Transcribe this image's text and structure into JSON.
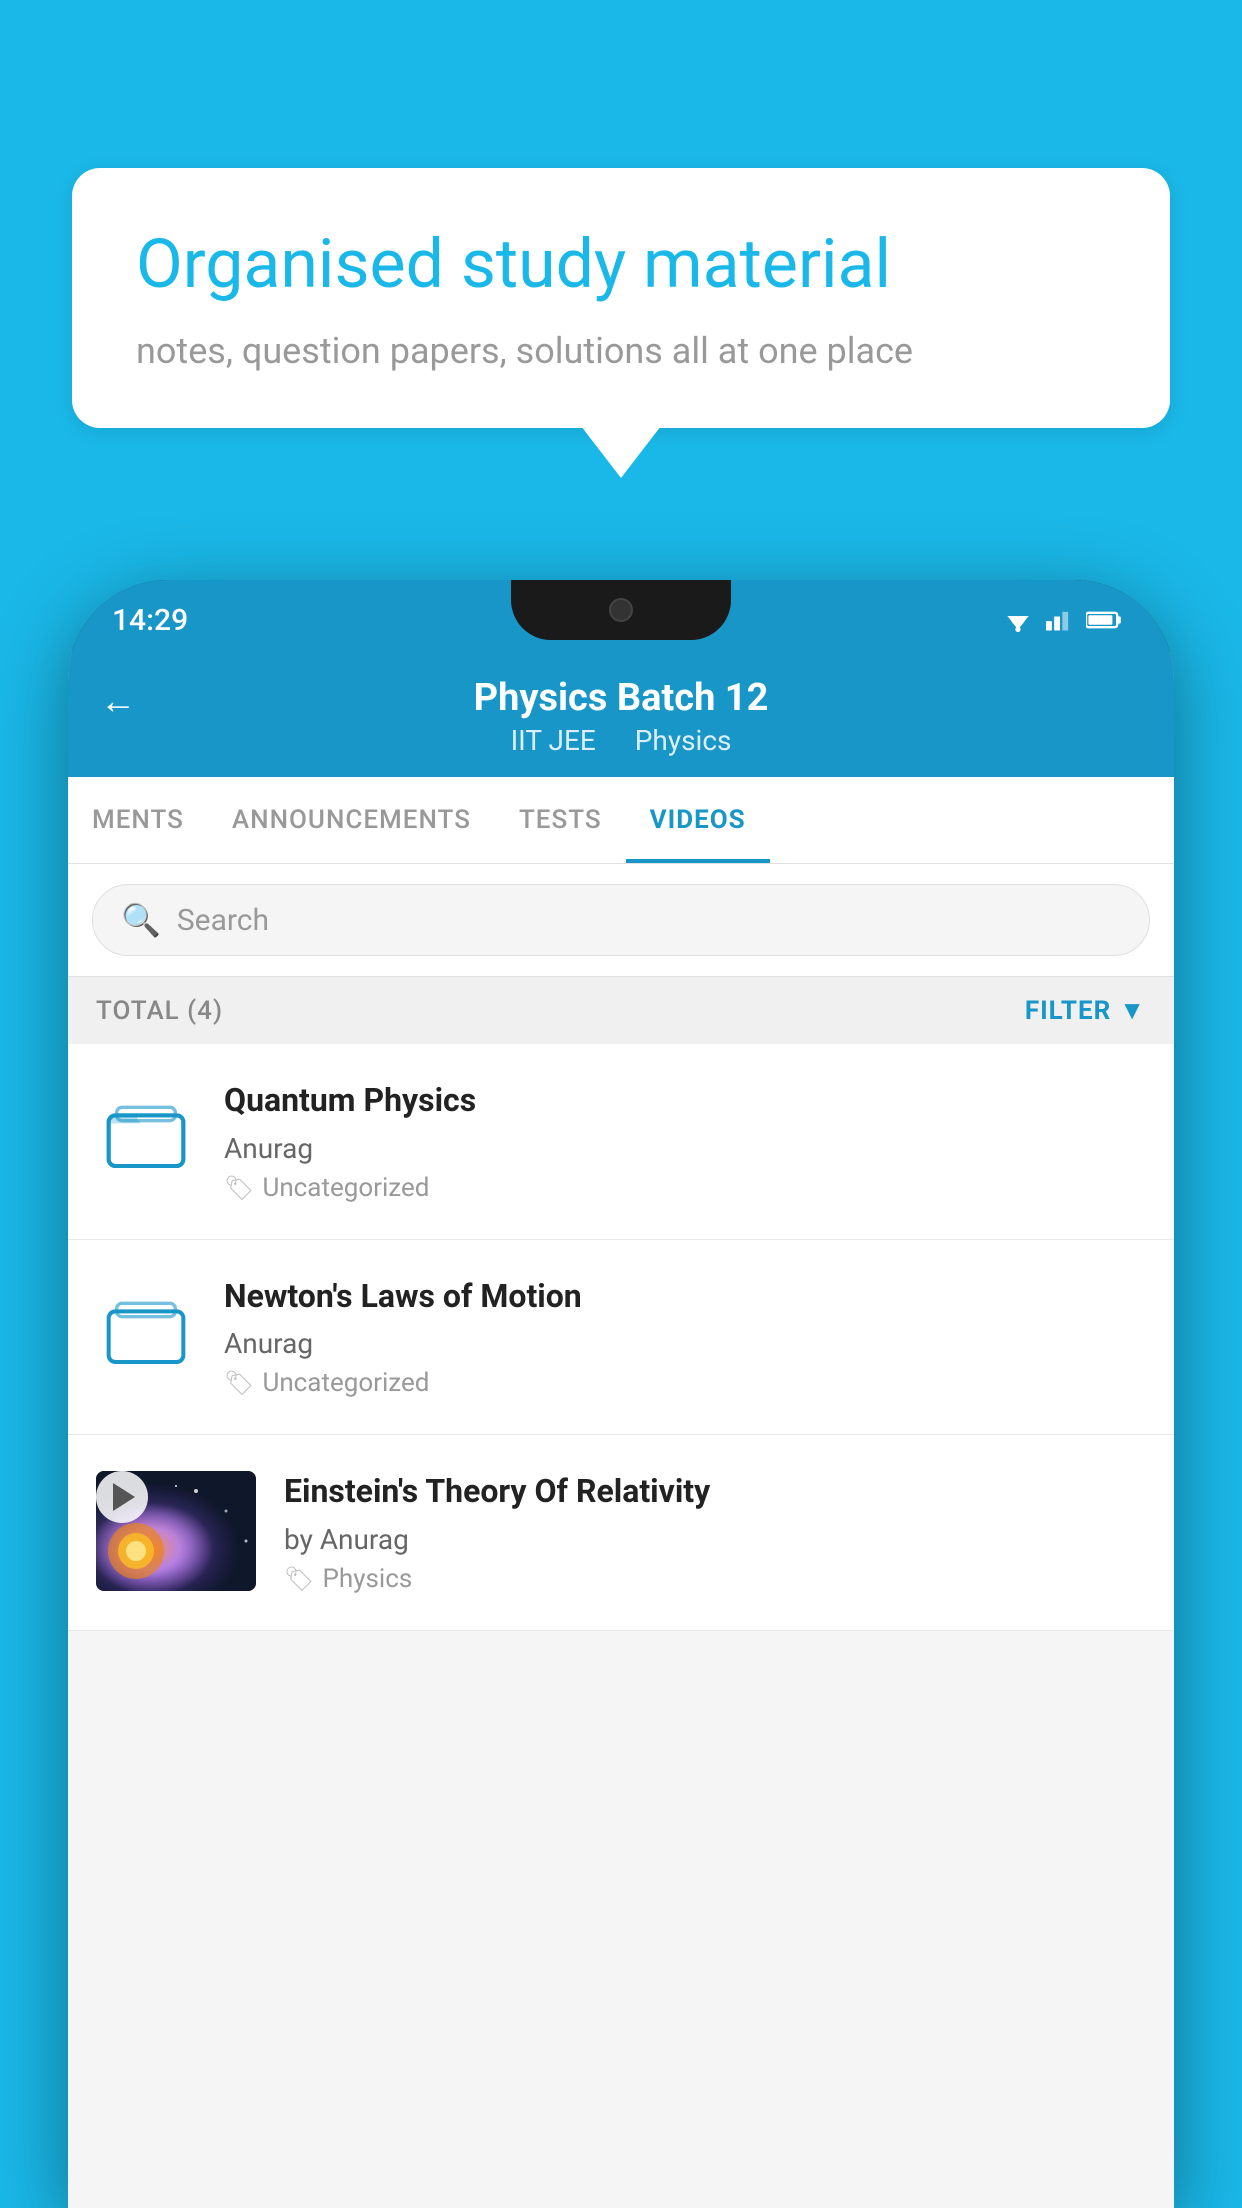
{
  "background_color": "#1AB8E8",
  "speech_bubble": {
    "title": "Organised study material",
    "subtitle": "notes, question papers, solutions all at one place"
  },
  "status_bar": {
    "time": "14:29"
  },
  "app_header": {
    "title": "Physics Batch 12",
    "subtitle_part1": "IIT JEE",
    "subtitle_part2": "Physics",
    "back_label": "←"
  },
  "tabs": [
    {
      "label": "MENTS",
      "active": false
    },
    {
      "label": "ANNOUNCEMENTS",
      "active": false
    },
    {
      "label": "TESTS",
      "active": false
    },
    {
      "label": "VIDEOS",
      "active": true
    }
  ],
  "search": {
    "placeholder": "Search"
  },
  "filter_bar": {
    "total_label": "TOTAL (4)",
    "filter_label": "FILTER"
  },
  "videos": [
    {
      "type": "folder",
      "title": "Quantum Physics",
      "author": "Anurag",
      "tag": "Uncategorized"
    },
    {
      "type": "folder",
      "title": "Newton's Laws of Motion",
      "author": "Anurag",
      "tag": "Uncategorized"
    },
    {
      "type": "video",
      "title": "Einstein's Theory Of Relativity",
      "author": "by Anurag",
      "tag": "Physics"
    }
  ]
}
